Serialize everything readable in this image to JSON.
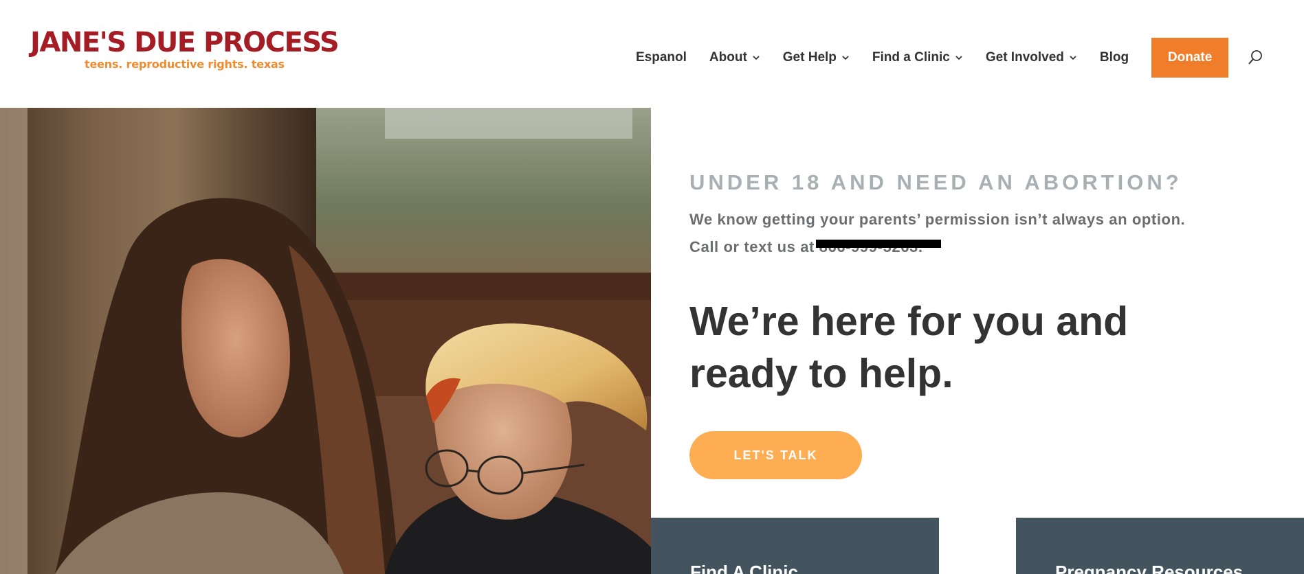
{
  "logo": {
    "title": "JANE'S DUE PROCESS",
    "tagline": "teens. reproductive rights. texas"
  },
  "nav": {
    "items": [
      {
        "label": "Espanol",
        "dropdown": false
      },
      {
        "label": "About",
        "dropdown": true
      },
      {
        "label": "Get Help",
        "dropdown": true
      },
      {
        "label": "Find a Clinic",
        "dropdown": true
      },
      {
        "label": "Get Involved",
        "dropdown": true
      },
      {
        "label": "Blog",
        "dropdown": false
      }
    ],
    "donate_label": "Donate",
    "search_icon": "search-icon"
  },
  "hero": {
    "eyebrow": "UNDER 18 AND NEED AN ABORTION?",
    "line1": "We know getting your parents’ permission isn’t always an option.",
    "line2": "Call or text us at 866-999-5263.",
    "headline_line1": "We’re here for you and",
    "headline_line2": "ready to help.",
    "cta_label": "LET'S TALK"
  },
  "cards": [
    {
      "label": "Find A Clinic"
    },
    {
      "label": "Pregnancy Resources"
    }
  ],
  "colors": {
    "brand_red": "#a51d24",
    "brand_orange": "#ef7d2a",
    "cta_orange": "#ffad52",
    "card_slate": "#44545e",
    "eyebrow_gray": "#a8b0b3"
  }
}
